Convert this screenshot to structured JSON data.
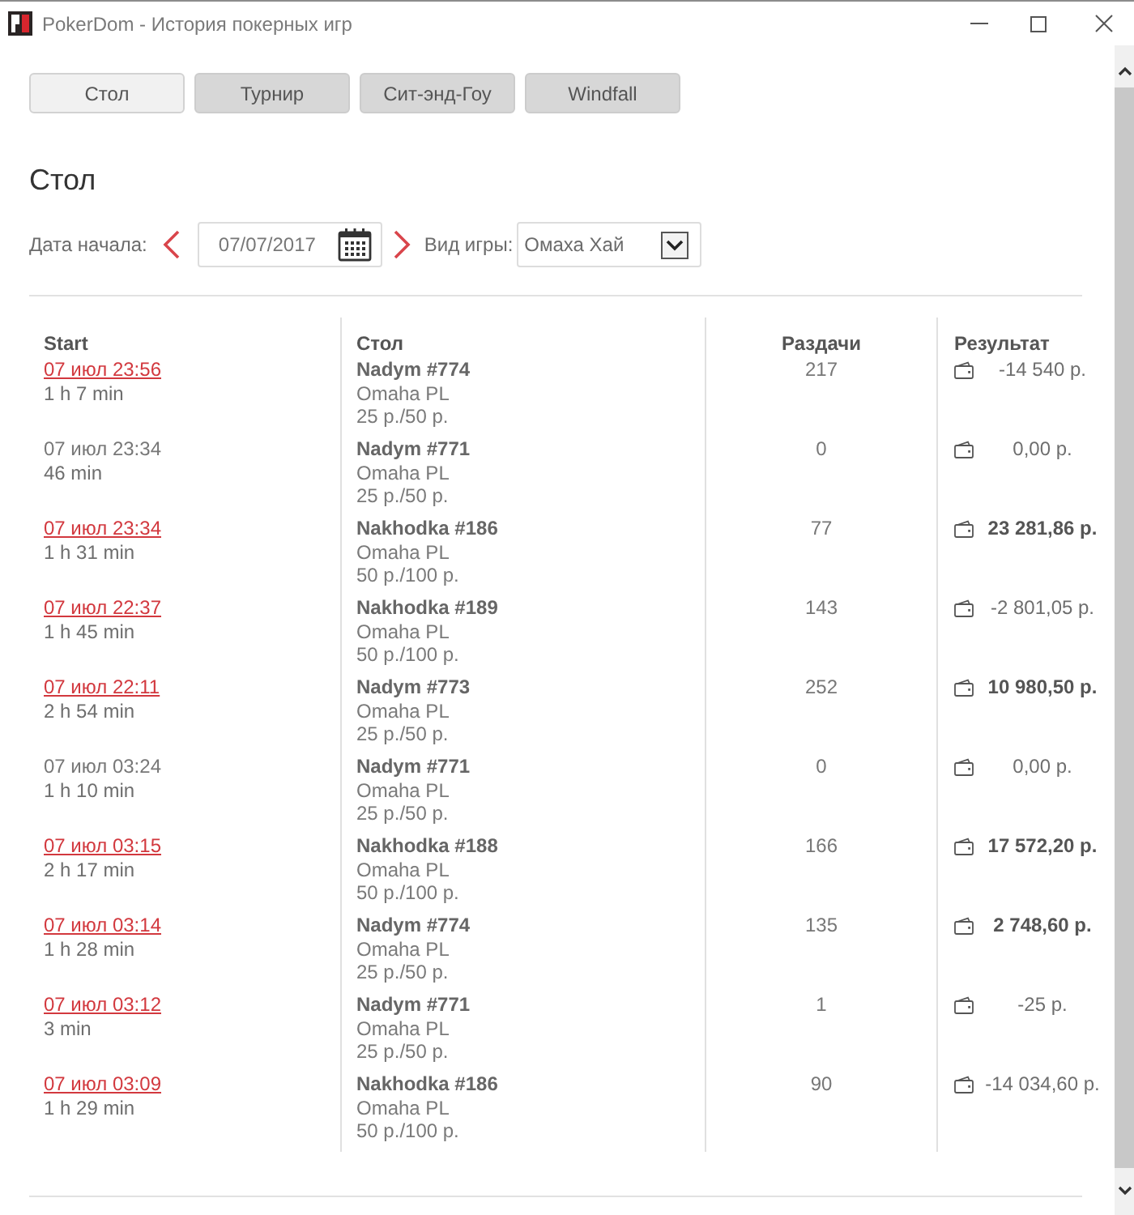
{
  "window": {
    "title": "PokerDom - История покерных игр"
  },
  "tabs": [
    {
      "label": "Стол",
      "selected": true
    },
    {
      "label": "Турнир",
      "selected": false
    },
    {
      "label": "Сит-энд-Гоу",
      "selected": false
    },
    {
      "label": "Windfall",
      "selected": false
    }
  ],
  "heading": "Стол",
  "filters": {
    "date_label": "Дата начала:",
    "date_value": "07/07/2017",
    "game_label": "Вид игры:",
    "game_value": "Омаха Хай"
  },
  "table": {
    "columns": [
      "Start",
      "Стол",
      "Раздачи",
      "Результат"
    ],
    "rows": [
      {
        "start": "07 июл 23:56",
        "linked": true,
        "duration": "1 h 7 min",
        "table": "Nadym #774",
        "game": "Omaha PL",
        "stakes": "25 р./50 р.",
        "hands": "217",
        "result": "-14 540 р.",
        "positive": false
      },
      {
        "start": "07 июл 23:34",
        "linked": false,
        "duration": "46 min",
        "table": "Nadym #771",
        "game": "Omaha PL",
        "stakes": "25 р./50 р.",
        "hands": "0",
        "result": "0,00 р.",
        "positive": false
      },
      {
        "start": "07 июл 23:34",
        "linked": true,
        "duration": "1 h 31 min",
        "table": "Nakhodka #186",
        "game": "Omaha PL",
        "stakes": "50 р./100 р.",
        "hands": "77",
        "result": "23 281,86 р.",
        "positive": true
      },
      {
        "start": "07 июл 22:37",
        "linked": true,
        "duration": "1 h 45 min",
        "table": "Nakhodka #189",
        "game": "Omaha PL",
        "stakes": "50 р./100 р.",
        "hands": "143",
        "result": "-2 801,05 р.",
        "positive": false
      },
      {
        "start": "07 июл 22:11",
        "linked": true,
        "duration": "2 h 54 min",
        "table": "Nadym #773",
        "game": "Omaha PL",
        "stakes": "25 р./50 р.",
        "hands": "252",
        "result": "10 980,50 р.",
        "positive": true
      },
      {
        "start": "07 июл 03:24",
        "linked": false,
        "duration": "1 h 10 min",
        "table": "Nadym #771",
        "game": "Omaha PL",
        "stakes": "25 р./50 р.",
        "hands": "0",
        "result": "0,00 р.",
        "positive": false
      },
      {
        "start": "07 июл 03:15",
        "linked": true,
        "duration": "2 h 17 min",
        "table": "Nakhodka #188",
        "game": "Omaha PL",
        "stakes": "50 р./100 р.",
        "hands": "166",
        "result": "17 572,20 р.",
        "positive": true
      },
      {
        "start": "07 июл 03:14",
        "linked": true,
        "duration": "1 h 28 min",
        "table": "Nadym #774",
        "game": "Omaha PL",
        "stakes": "25 р./50 р.",
        "hands": "135",
        "result": "2 748,60 р.",
        "positive": true
      },
      {
        "start": "07 июл 03:12",
        "linked": true,
        "duration": "3 min",
        "table": "Nadym #771",
        "game": "Omaha PL",
        "stakes": "25 р./50 р.",
        "hands": "1",
        "result": "-25 р.",
        "positive": false
      },
      {
        "start": "07 июл 03:09",
        "linked": true,
        "duration": "1 h 29 min",
        "table": "Nakhodka #186",
        "game": "Omaha PL",
        "stakes": "50 р./100 р.",
        "hands": "90",
        "result": "-14 034,60 р.",
        "positive": false
      }
    ]
  }
}
